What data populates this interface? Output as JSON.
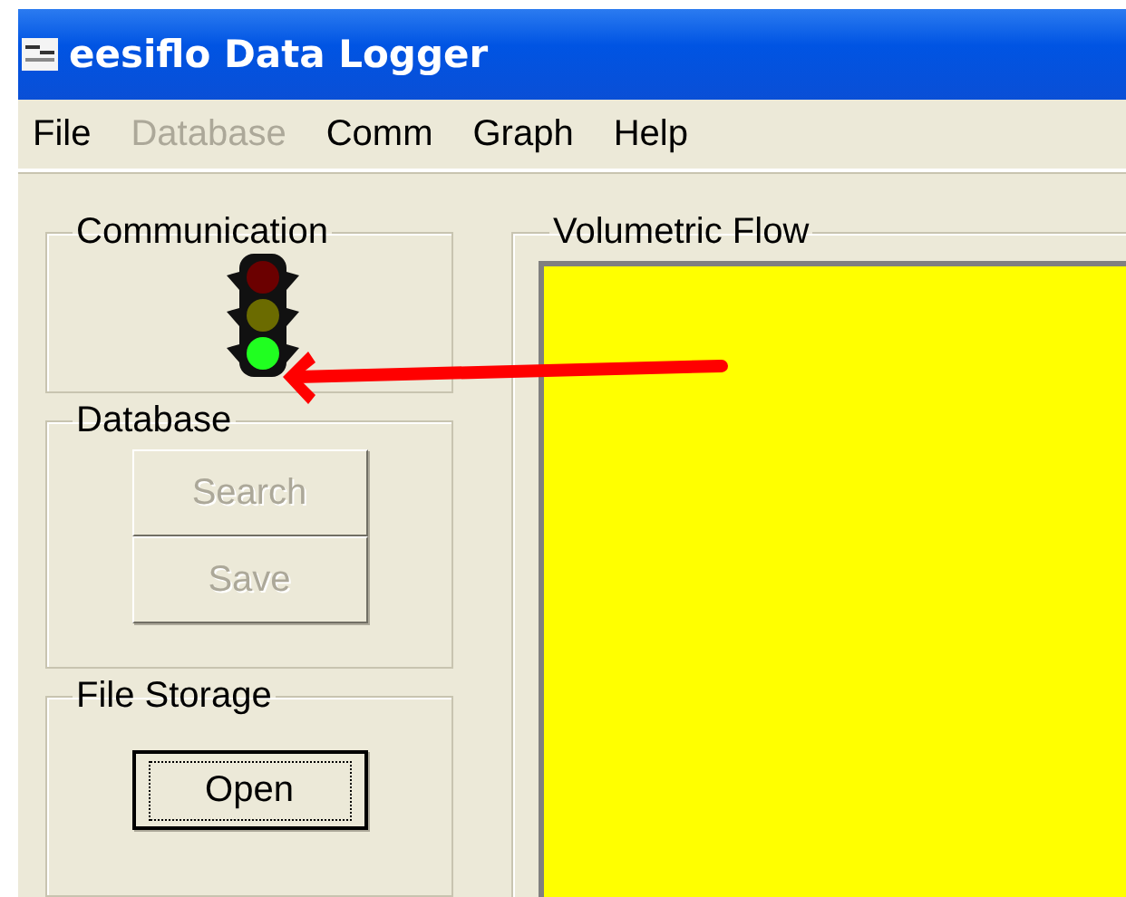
{
  "window": {
    "title": "eesiflo Data Logger"
  },
  "menu": [
    {
      "label": "File",
      "disabled": false
    },
    {
      "label": "Database",
      "disabled": true
    },
    {
      "label": "Comm",
      "disabled": false
    },
    {
      "label": "Graph",
      "disabled": false
    },
    {
      "label": "Help",
      "disabled": false
    }
  ],
  "communication": {
    "title": "Communication",
    "lamps": [
      {
        "lit": false
      },
      {
        "lit": false
      },
      {
        "lit": true
      }
    ]
  },
  "database": {
    "title": "Database",
    "buttons": [
      {
        "label": "Search",
        "disabled": true
      },
      {
        "label": "Save",
        "disabled": true
      }
    ]
  },
  "file_storage": {
    "title": "File Storage",
    "buttons": [
      {
        "label": "Open",
        "disabled": false,
        "focused": true
      }
    ]
  },
  "graph": {
    "title": "Volumetric Flow"
  }
}
